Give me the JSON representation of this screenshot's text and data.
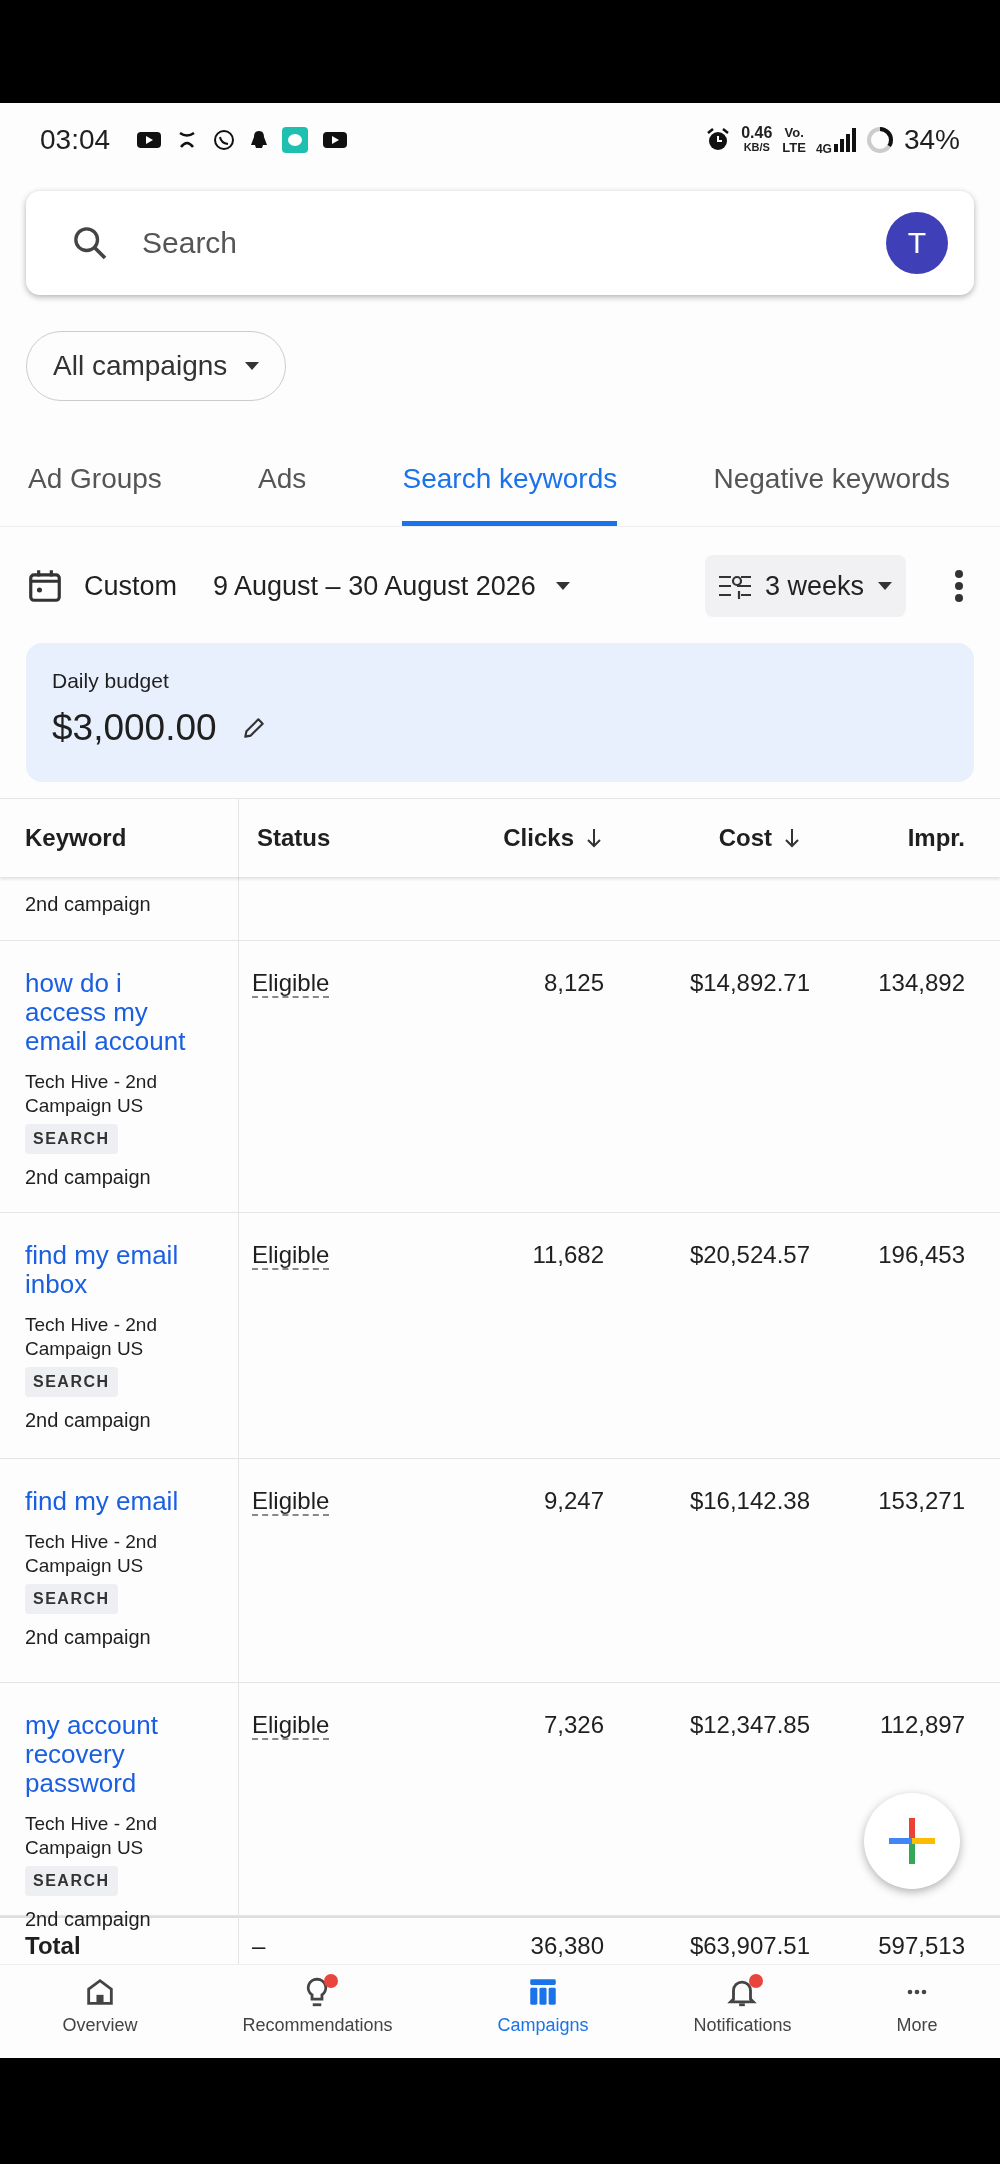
{
  "status_bar": {
    "time": "03:04",
    "speed": "0.46",
    "speed_unit": "KB/S",
    "volte_top": "Vo.",
    "volte_bottom": "LTE",
    "network": "4G",
    "battery": "34%"
  },
  "search": {
    "placeholder": "Search",
    "avatar": "T"
  },
  "campaign_filter": {
    "label": "All campaigns"
  },
  "tabs": [
    {
      "label": "Ad Groups",
      "selected": false
    },
    {
      "label": "Ads",
      "selected": false
    },
    {
      "label": "Search keywords",
      "selected": true
    },
    {
      "label": "Negative keywords",
      "selected": false
    }
  ],
  "date_range": {
    "label": "Custom",
    "range": "9 August – 30 August 2026",
    "period": "3 weeks"
  },
  "budget": {
    "label": "Daily budget",
    "amount": "$3,000.00"
  },
  "table": {
    "columns": [
      {
        "label": "Keyword",
        "sorted": false
      },
      {
        "label": "Status",
        "sorted": false
      },
      {
        "label": "Clicks",
        "sorted": true
      },
      {
        "label": "Cost",
        "sorted": true
      },
      {
        "label": "Impr.",
        "sorted": false
      }
    ],
    "partial_row": {
      "campaign": "2nd campaign"
    },
    "rows": [
      {
        "keyword": "how do i access my email account",
        "ad_group": "Tech Hive - 2nd Campaign US",
        "tag": "SEARCH",
        "campaign": "2nd campaign",
        "status": "Eligible",
        "clicks": "8,125",
        "cost": "$14,892.71",
        "impr": "134,892"
      },
      {
        "keyword": "find my email inbox",
        "ad_group": "Tech Hive - 2nd Campaign US",
        "tag": "SEARCH",
        "campaign": "2nd campaign",
        "status": "Eligible",
        "clicks": "11,682",
        "cost": "$20,524.57",
        "impr": "196,453"
      },
      {
        "keyword": "find my email",
        "ad_group": "Tech Hive - 2nd Campaign US",
        "tag": "SEARCH",
        "campaign": "2nd campaign",
        "status": "Eligible",
        "clicks": "9,247",
        "cost": "$16,142.38",
        "impr": "153,271"
      },
      {
        "keyword": "my account recovery password",
        "ad_group": "Tech Hive - 2nd Campaign US",
        "tag": "SEARCH",
        "campaign": "2nd campaign",
        "status": "Eligible",
        "clicks": "7,326",
        "cost": "$12,347.85",
        "impr": "112,897"
      }
    ],
    "total": {
      "label": "Total",
      "status": "–",
      "clicks": "36,380",
      "cost": "$63,907.51",
      "impr": "597,513"
    }
  },
  "bottom_nav": [
    {
      "label": "Overview",
      "selected": false,
      "badge": false
    },
    {
      "label": "Recommendations",
      "selected": false,
      "badge": true
    },
    {
      "label": "Campaigns",
      "selected": true,
      "badge": false
    },
    {
      "label": "Notifications",
      "selected": false,
      "badge": true
    },
    {
      "label": "More",
      "selected": false,
      "badge": false
    }
  ]
}
